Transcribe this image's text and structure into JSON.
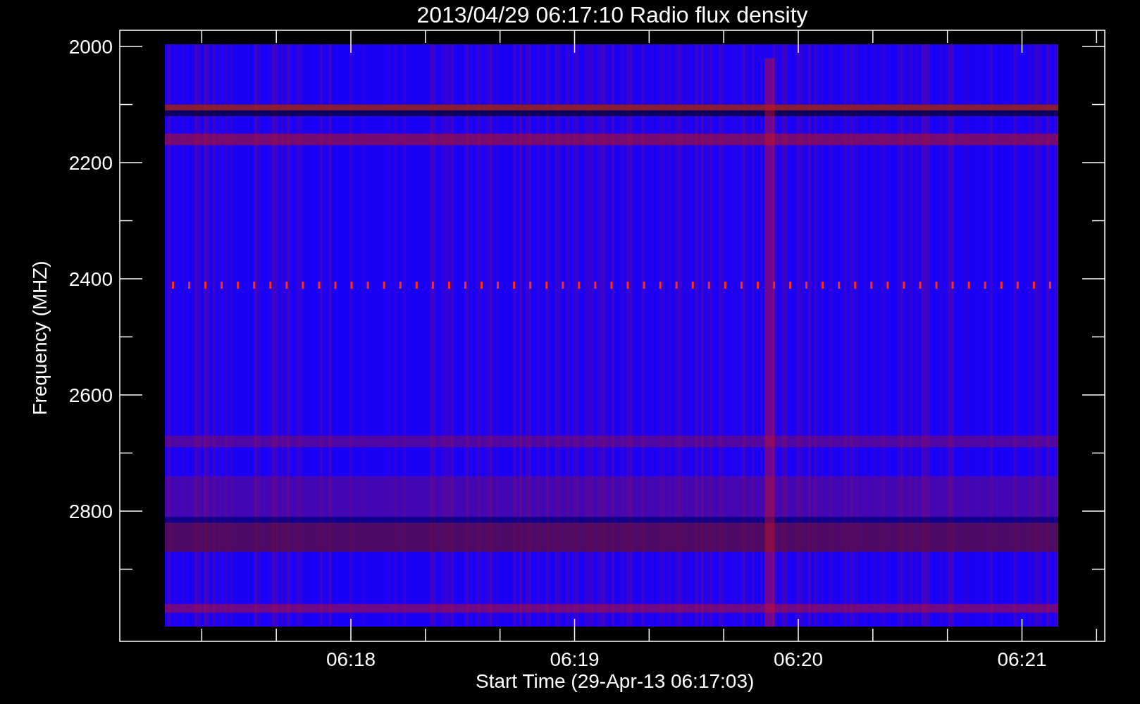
{
  "plot": {
    "title": "2013/04/29 06:17:10 Radio flux density",
    "y_axis": {
      "label": "Frequency (MHZ)",
      "ticks": [
        "2000",
        "2200",
        "2400",
        "2600",
        "2800"
      ]
    },
    "x_axis": {
      "label": "Start Time (29-Apr-13 06:17:03)",
      "ticks": [
        "06:18",
        "06:19",
        "06:20",
        "06:21"
      ]
    }
  }
}
